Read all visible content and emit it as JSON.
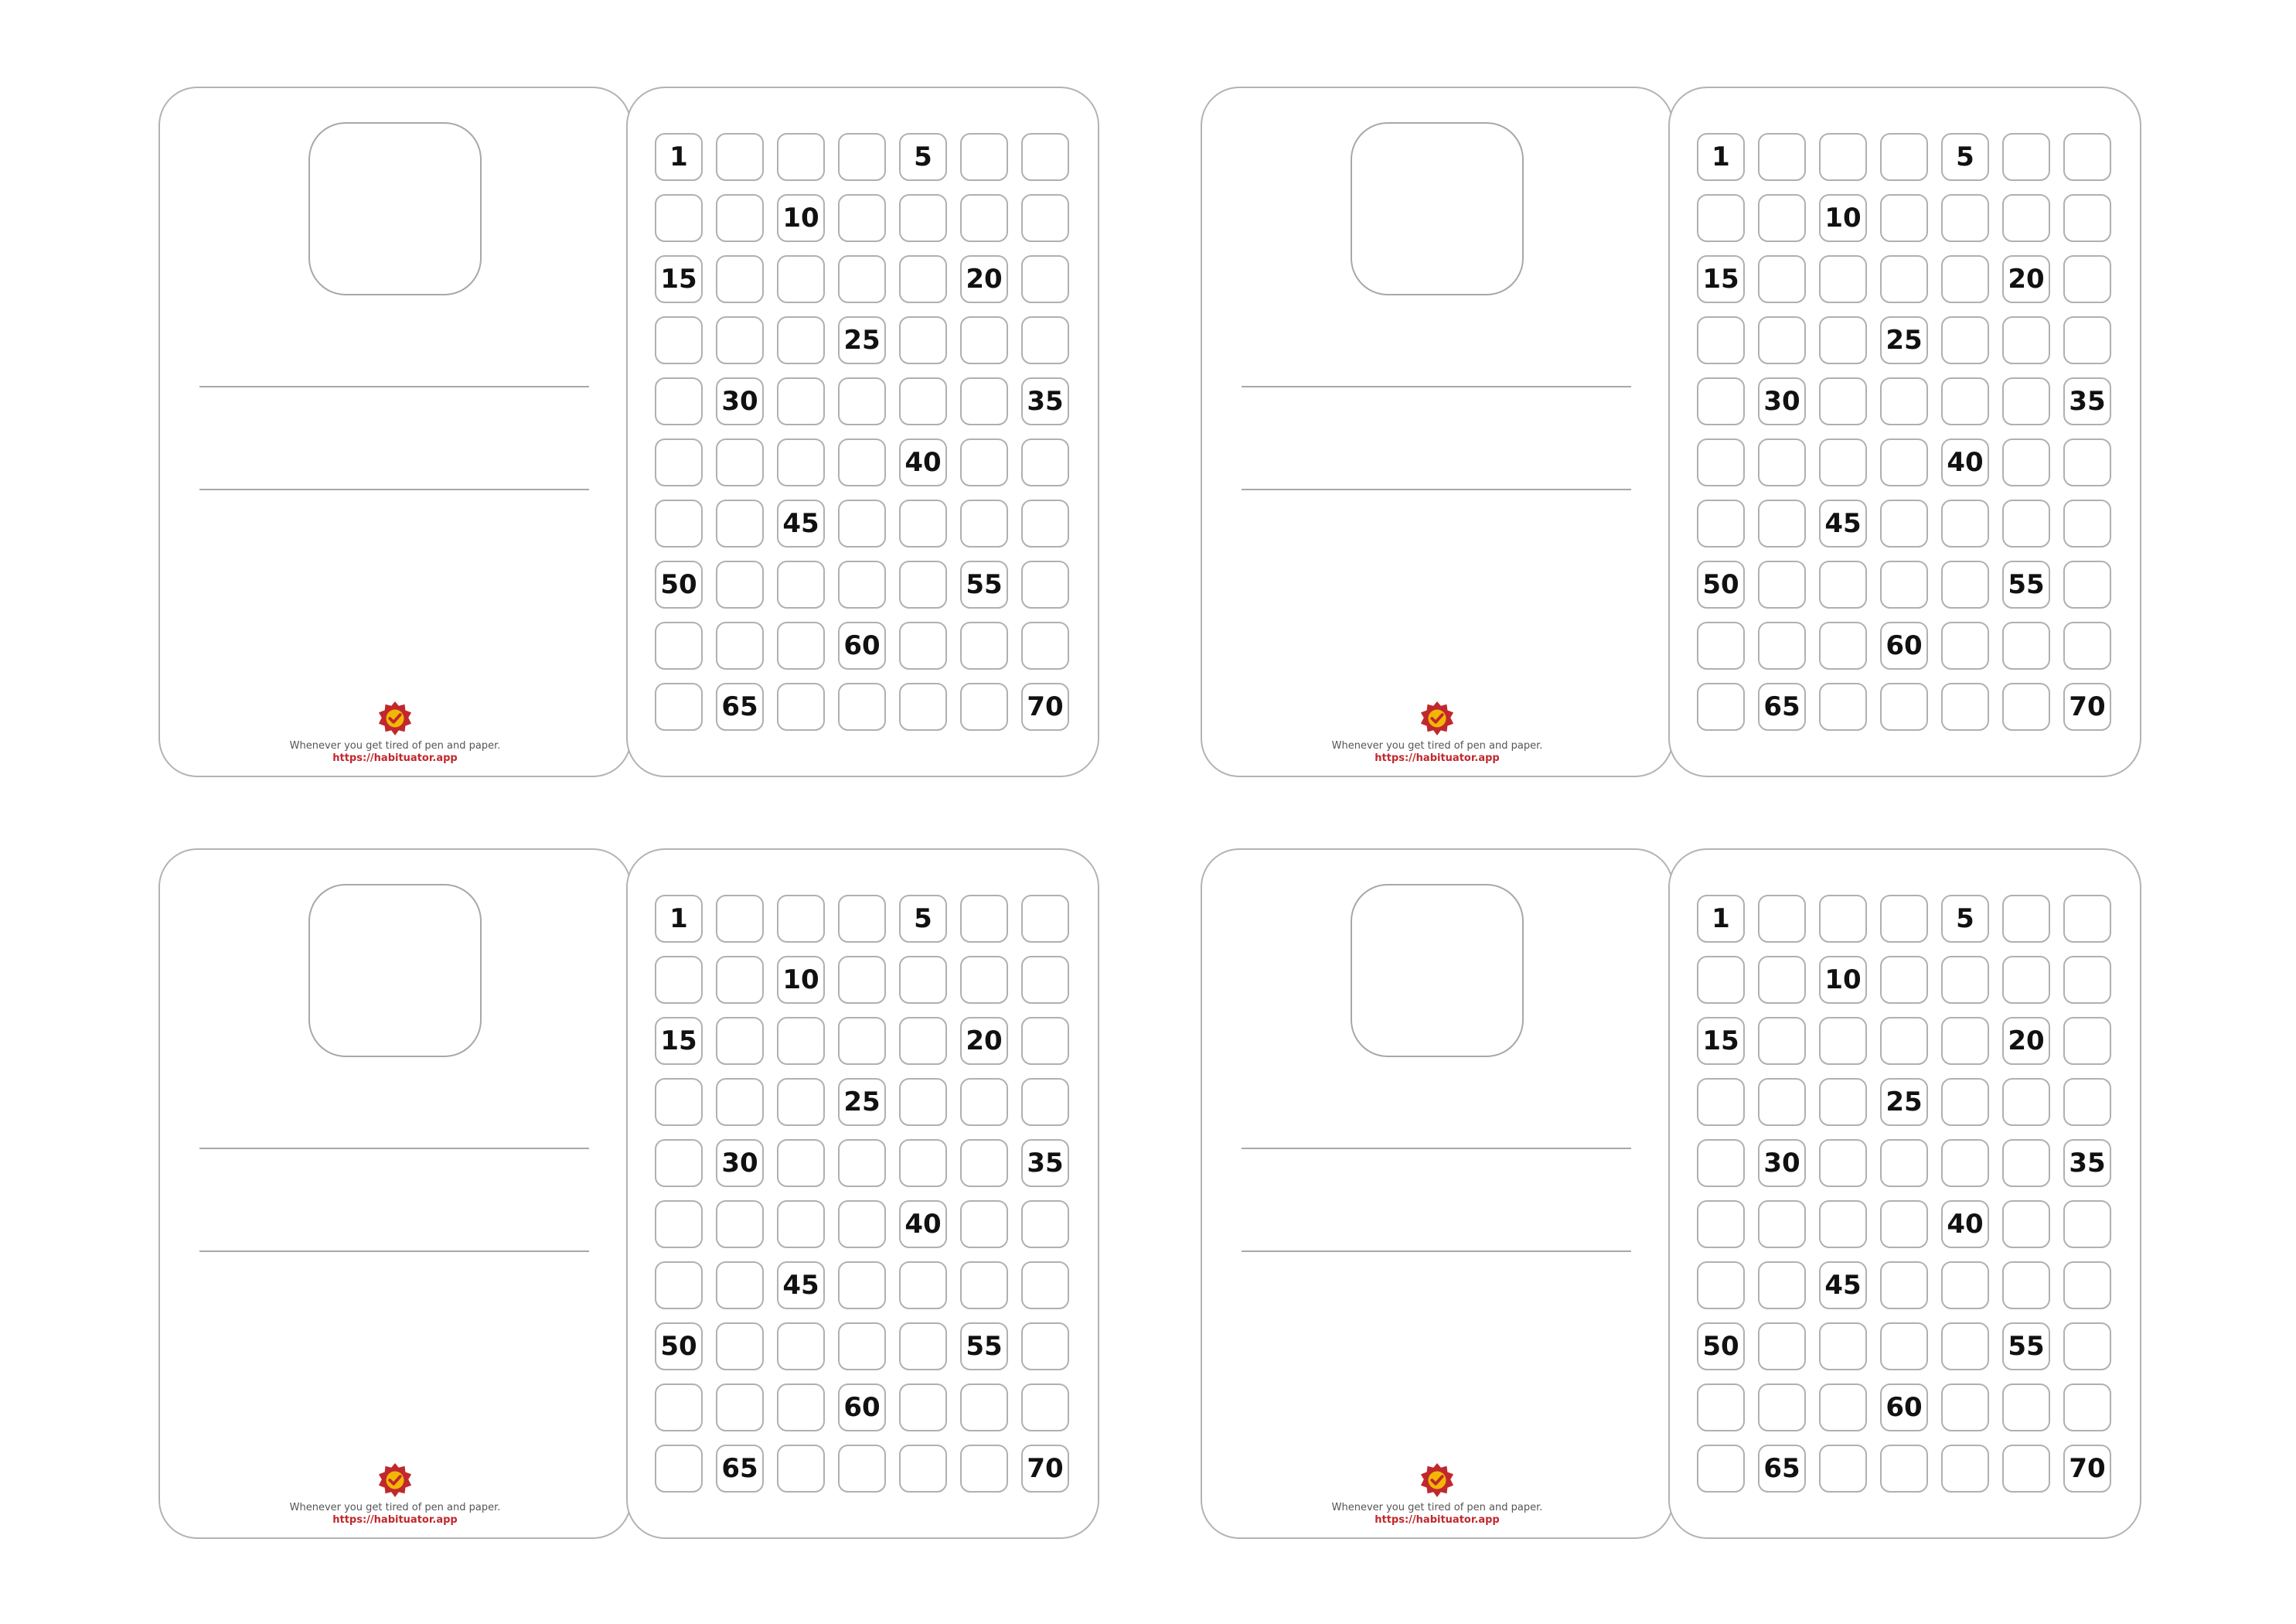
{
  "page": {
    "background": "#ffffff"
  },
  "brand": {
    "tagline": "Whenever you get tired of pen and paper.",
    "url": "https://habituator.app",
    "badge_icon": "check-seal-icon",
    "badge_colors": {
      "outer": "#c0282d",
      "inner": "#f2b705",
      "check": "#c0282d"
    }
  },
  "grid": {
    "columns": 7,
    "rows": 10,
    "total_days": 70,
    "labeled_every": 5,
    "first_label": 1,
    "labels": [
      "1",
      "5",
      "10",
      "15",
      "20",
      "25",
      "30",
      "35",
      "40",
      "45",
      "50",
      "55",
      "60",
      "65",
      "70"
    ]
  },
  "cards": [
    {
      "id": "card-1"
    },
    {
      "id": "card-2"
    },
    {
      "id": "card-3"
    },
    {
      "id": "card-4"
    }
  ]
}
